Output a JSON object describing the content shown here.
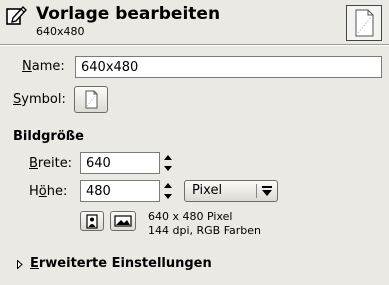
{
  "header": {
    "title": "Vorlage bearbeiten",
    "subtitle": "640x480",
    "icon": "edit-template-icon",
    "thumbnail_icon": "document-icon"
  },
  "name_field": {
    "label_accel": "N",
    "label_rest": "ame:",
    "value": "640x480"
  },
  "symbol": {
    "label_accel": "S",
    "label_rest": "ymbol:",
    "icon": "document-icon"
  },
  "image_size": {
    "heading": "Bildgröße",
    "width_label_accel": "B",
    "width_label_rest": "reite:",
    "width_value": "640",
    "height_label_head": "H",
    "height_label_accel": "ö",
    "height_label_rest": "he:",
    "height_value": "480",
    "unit": "Pixel",
    "portrait_icon": "portrait-orientation-icon",
    "landscape_icon": "landscape-orientation-icon",
    "info_line1": "640 x 480 Pixel",
    "info_line2": "144 dpi, RGB Farben"
  },
  "advanced": {
    "label_accel": "E",
    "label_rest": "rweiterte Einstellungen",
    "icon": "expander-arrow-icon"
  }
}
